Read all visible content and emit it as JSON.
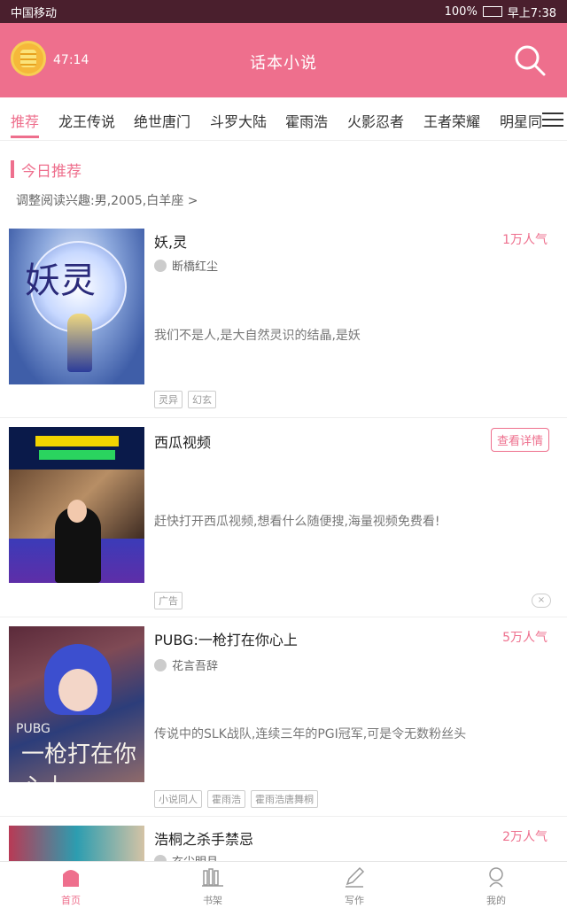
{
  "status_bar": {
    "carrier": "中国移动",
    "battery": "100%",
    "time": "早上7:38"
  },
  "header": {
    "timer": "47:14",
    "title": "话本小说"
  },
  "tabs": [
    "推荐",
    "龙王传说",
    "绝世唐门",
    "斗罗大陆",
    "霍雨浩",
    "火影忍者",
    "王者荣耀",
    "明星同"
  ],
  "section": {
    "title": "今日推荐",
    "interest": "调整阅读兴趣:男,2005,白羊座"
  },
  "books": [
    {
      "title": "妖,灵",
      "popularity": "1万人气",
      "author": "断橋红尘",
      "desc": "我们不是人,是大自然灵识的结晶,是妖",
      "tags": [
        "灵异",
        "幻玄"
      ],
      "cover_text": "妖灵"
    },
    {
      "title": "西瓜视频",
      "action": "查看详情",
      "desc": "赶快打开西瓜视频,想看什么随便搜,海量视频免费看!",
      "tags": [
        "广告"
      ]
    },
    {
      "title": "PUBG:一枪打在你心上",
      "popularity": "5万人气",
      "author": "花言吾辞",
      "desc": "传说中的SLK战队,连续三年的PGI冠军,可是令无数粉丝头",
      "tags": [
        "小说同人",
        "霍雨浩",
        "霍雨浩唐舞桐"
      ],
      "cover_text": "一枪打在你心上"
    },
    {
      "title": "浩桐之杀手禁忌",
      "popularity": "2万人气",
      "author": "玄尘明月"
    }
  ],
  "bottom_nav": [
    "首页",
    "书架",
    "写作",
    "我的"
  ],
  "colors": {
    "accent": "#ee6f8d",
    "status_bar": "#4a1f2d"
  }
}
